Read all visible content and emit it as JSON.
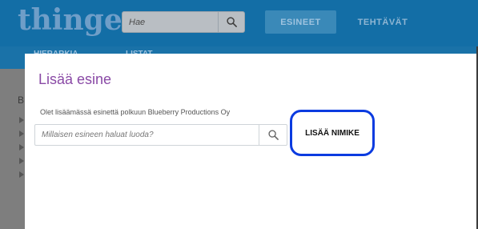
{
  "app": {
    "logo": "thinger",
    "search_placeholder": "Hae",
    "nav": {
      "items_label": "ESINEET",
      "tasks_label": "TEHTÄVÄT"
    },
    "subnav": {
      "hierarchy_label": "HIERARKIA",
      "lists_label": "LISTAT"
    },
    "side_letter": "B"
  },
  "modal": {
    "title": "Lisää esine",
    "info": "Olet lisäämässä esinettä polkuun Blueberry Productions Oy",
    "search_placeholder": "Millaisen esineen haluat luoda?",
    "add_name_label": "LISÄÄ NIMIKE"
  },
  "colors": {
    "header_bg": "#136ea6",
    "title_purple": "#8a4aa6",
    "highlight_ring": "#0b3be0"
  },
  "icons": {
    "search": "search-icon"
  }
}
